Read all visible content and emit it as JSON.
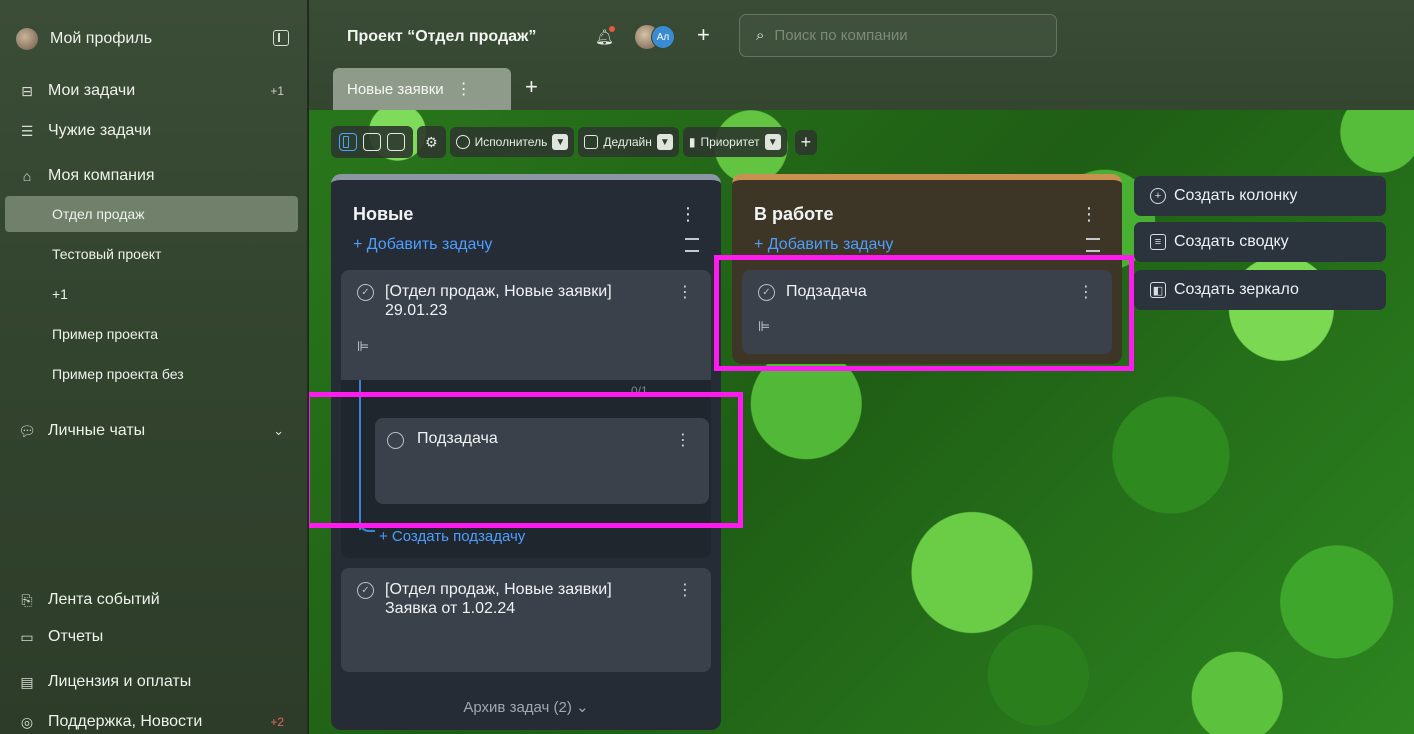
{
  "sidebar": {
    "profile": "Мой профиль",
    "my_tasks": "Мои задачи",
    "my_tasks_badge": "+1",
    "others_tasks": "Чужие задачи",
    "my_company": "Моя компания",
    "projects": [
      "Отдел продаж",
      "Тестовый проект",
      "+1",
      "Пример проекта",
      "Пример проекта без"
    ],
    "personal_chats": "Личные чаты",
    "events": "Лента событий",
    "reports": "Отчеты",
    "license": "Лицензия и оплаты",
    "support": "Поддержка, Новости",
    "support_badge": "+2"
  },
  "header": {
    "project_title": "Проект “Отдел продаж”",
    "avatar_initials": "Ал",
    "search_placeholder": "Поиск по компании"
  },
  "tabs": [
    {
      "label": "Новые заявки",
      "active": true
    }
  ],
  "toolbar": {
    "filters": [
      "Исполнитель",
      "Дедлайн",
      "Приоритет"
    ]
  },
  "columns": {
    "new": {
      "title": "Новые",
      "add_task": "+ Добавить задачу",
      "card1": "[Отдел продаж, Новые заявки] 29.01.23",
      "progress": "0/1",
      "subtask": "Подзадача",
      "create_subtask": "+ Создать подзадачу",
      "card2": "[Отдел продаж, Новые заявки] Заявка от 1.02.24",
      "archive": "Архив задач (2) ⌄"
    },
    "work": {
      "title": "В работе",
      "add_task": "+ Добавить задачу",
      "card1": "Подзадача"
    }
  },
  "actions": {
    "create_column": "Создать колонку",
    "create_summary": "Создать сводку",
    "create_mirror": "Создать зеркало"
  },
  "colors": {
    "accent": "#4d9eff",
    "highlight": "#ff1bee"
  }
}
